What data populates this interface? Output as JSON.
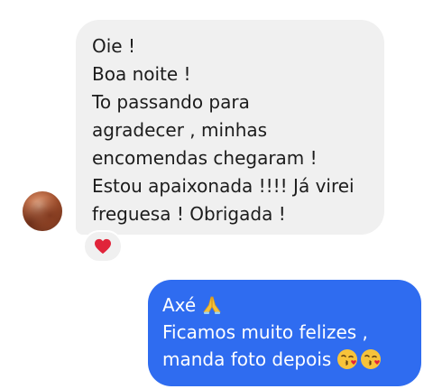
{
  "incoming_message": {
    "lines": [
      "Oie !",
      "Boa noite !",
      "To passando para",
      "agradecer , minhas",
      "encomendas chegaram !",
      "Estou apaixonada !!!! Já virei",
      "freguesa ! Obrigada !"
    ],
    "reaction_icon": "heart-icon",
    "reaction_color": "#e0243a"
  },
  "outgoing_message": {
    "line1_text": "Axé",
    "line1_icon": "folded-hands-icon",
    "line2": "Ficamos muito felizes ,",
    "line3_text": "manda foto depois",
    "line3_icons": [
      "kissing-face-icon",
      "kissing-face-icon"
    ],
    "bubble_color": "#2f6cf0"
  }
}
